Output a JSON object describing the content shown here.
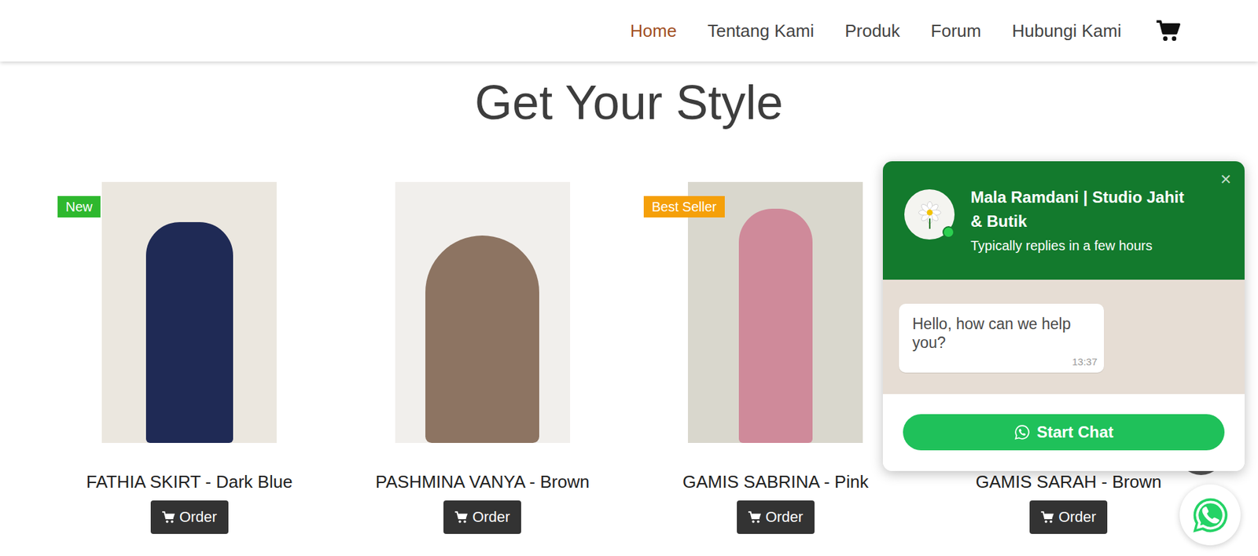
{
  "nav": {
    "items": [
      {
        "label": "Home",
        "selected": true
      },
      {
        "label": "Tentang Kami",
        "selected": false
      },
      {
        "label": "Produk",
        "selected": false
      },
      {
        "label": "Forum",
        "selected": false
      },
      {
        "label": "Hubungi Kami",
        "selected": false
      }
    ]
  },
  "heading": "Get Your Style",
  "products": [
    {
      "name": "FATHIA SKIRT - Dark Blue",
      "badge": {
        "label": "New",
        "color": "#2eb82e"
      },
      "button": "Order"
    },
    {
      "name": "PASHMINA VANYA - Brown",
      "badge": null,
      "button": "Order"
    },
    {
      "name": "GAMIS SABRINA - Pink",
      "badge": {
        "label": "Best Seller",
        "color": "#f5a00a"
      },
      "button": "Order"
    },
    {
      "name": "GAMIS SARAH - Brown",
      "badge": null,
      "button": "Order"
    }
  ],
  "chat": {
    "close": "×",
    "title": "Mala Ramdani | Studio Jahit & Butik",
    "status": "Typically replies in a few hours",
    "online": true,
    "messages": [
      {
        "text": "Hello, how can we help you?",
        "time": "13:37"
      }
    ],
    "button": "Start Chat"
  }
}
